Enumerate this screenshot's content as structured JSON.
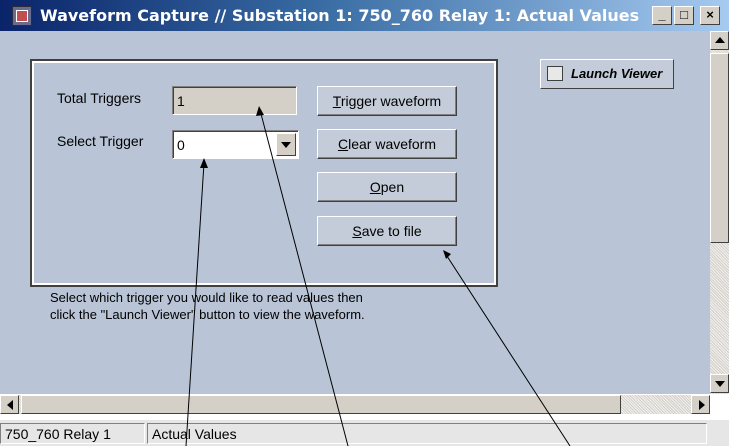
{
  "window": {
    "title": "Waveform Capture // Substation 1: 750_760 Relay 1: Actual Values",
    "minimize": "_",
    "maximize": "□",
    "close": "×"
  },
  "form": {
    "total_triggers_label": "Total Triggers",
    "total_triggers_value": "1",
    "select_trigger_label": "Select Trigger",
    "select_trigger_value": "0"
  },
  "buttons": {
    "trigger_waveform": {
      "mnemonic": "T",
      "rest": "rigger waveform"
    },
    "clear_waveform": {
      "mnemonic": "C",
      "rest": "lear waveform"
    },
    "open": {
      "mnemonic": "O",
      "rest": "pen"
    },
    "save_to_file": {
      "mnemonic": "S",
      "rest": "ave to file"
    },
    "launch_viewer": "Launch Viewer"
  },
  "instructions": "Select which trigger you would like to read values then click the \"Launch Viewer\" button to view the waveform.",
  "statusbar": {
    "device": "750_760 Relay 1",
    "view": "Actual Values"
  },
  "colors": {
    "titlebar_start": "#0a246a",
    "titlebar_end": "#a6caf0",
    "content_bg": "#b9c5d6"
  },
  "icons": [
    "app-icon",
    "launch-viewer-icon",
    "dropdown-arrow-icon",
    "scroll-up-icon",
    "scroll-down-icon",
    "scroll-left-icon",
    "scroll-right-icon"
  ]
}
